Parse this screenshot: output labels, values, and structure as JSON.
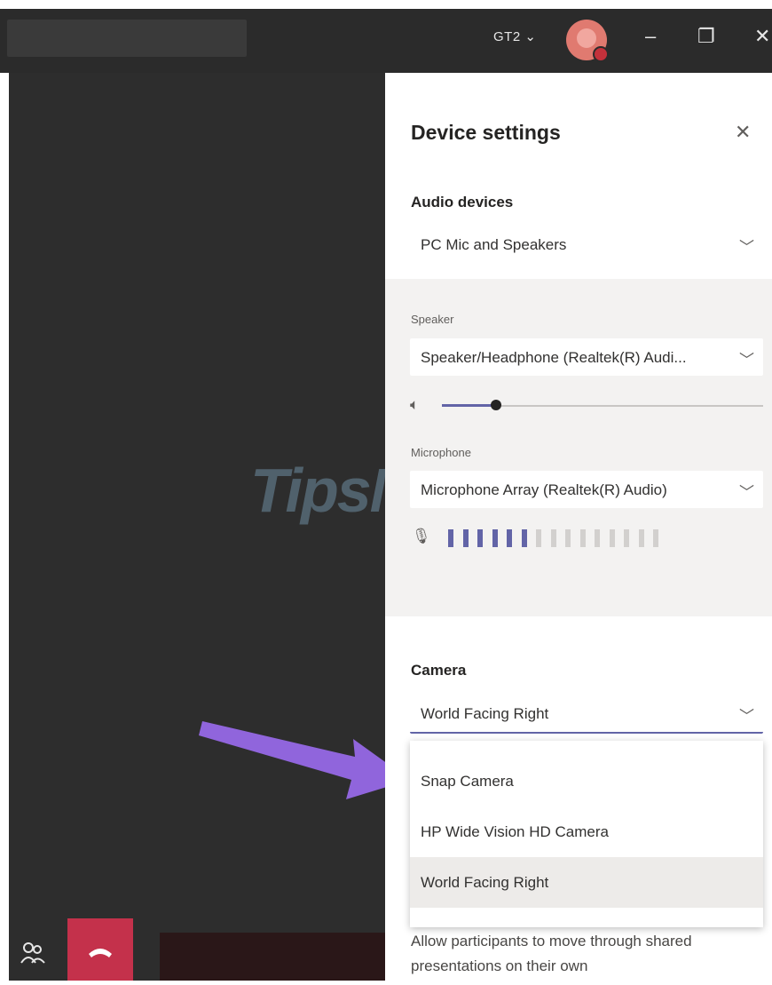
{
  "titlebar": {
    "tenant_label": "GT2",
    "tenant_chevron": "⌄",
    "minimize": "–",
    "maximize": "❐",
    "close": "✕"
  },
  "panel": {
    "title": "Device settings",
    "close": "✕",
    "audio": {
      "heading": "Audio devices",
      "selected": "PC Mic and Speakers"
    },
    "speaker": {
      "label": "Speaker",
      "selected": "Speaker/Headphone (Realtek(R) Audi...",
      "volume_fraction": 0.17
    },
    "microphone": {
      "label": "Microphone",
      "selected": "Microphone Array (Realtek(R) Audio)",
      "level_active_bars": 6,
      "level_total_bars": 15
    },
    "camera": {
      "heading": "Camera",
      "selected": "World Facing Right",
      "options": [
        "Snap Camera",
        "HP Wide Vision HD Camera",
        "World Facing Right"
      ],
      "highlighted_option": "World Facing Right"
    },
    "footer_text": "Allow participants to move through shared presentations on their own"
  },
  "watermark": "TipsMake",
  "colors": {
    "accent": "#6264a7",
    "hangup": "#c4314b",
    "arrow": "#9b6cf0"
  }
}
